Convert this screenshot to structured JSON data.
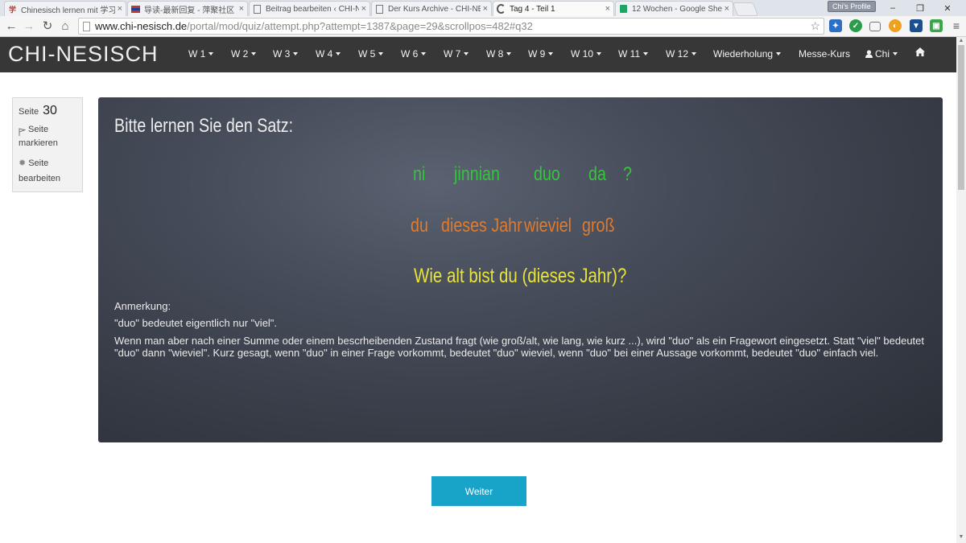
{
  "browser": {
    "tabs": [
      {
        "label": "Chinesisch lernen mit 学习",
        "icon": "chinese-char-favicon"
      },
      {
        "label": "导读-最新回复 - 萍聚社区",
        "icon": "flag-favicon"
      },
      {
        "label": "Beitrag bearbeiten ‹ CHI-N",
        "icon": "page-favicon"
      },
      {
        "label": "Der Kurs Archive - CHI-NE",
        "icon": "page-favicon"
      },
      {
        "label": "Tag 4 - Teil 1",
        "icon": "loading-favicon"
      },
      {
        "label": "12 Wochen - Google Shee",
        "icon": "sheets-favicon"
      }
    ],
    "profile_label": "Chi's Profile",
    "url_host": "www.chi-nesisch.de",
    "url_path": "/portal/mod/quiz/attempt.php?attempt=1387&page=29&scrollpos=482#q32",
    "colors": {
      "tabstrip": "#dfe3ea",
      "sheets_green": "#1fa463"
    }
  },
  "site": {
    "logo": "CHI-NESISCH",
    "menu": [
      {
        "label": "W 1",
        "dropdown": true
      },
      {
        "label": "W 2",
        "dropdown": true
      },
      {
        "label": "W 3",
        "dropdown": true
      },
      {
        "label": "W 4",
        "dropdown": true
      },
      {
        "label": "W 5",
        "dropdown": true
      },
      {
        "label": "W 6",
        "dropdown": true
      },
      {
        "label": "W 7",
        "dropdown": true
      },
      {
        "label": "W 8",
        "dropdown": true
      },
      {
        "label": "W 9",
        "dropdown": true
      },
      {
        "label": "W 10",
        "dropdown": true
      },
      {
        "label": "W 11",
        "dropdown": true
      },
      {
        "label": "W 12",
        "dropdown": true
      },
      {
        "label": "Wiederholung",
        "dropdown": true
      },
      {
        "label": "Messe-Kurs",
        "dropdown": false
      },
      {
        "label": "Chi",
        "dropdown": true,
        "icon": "user-icon"
      }
    ],
    "home_icon": "home-icon",
    "colors": {
      "navbar": "#373737",
      "button": "#18a3c8"
    }
  },
  "sidebar": {
    "page_label": "Seite",
    "page_number": "30",
    "flag_text_1": "Seite",
    "flag_text_2": "markieren",
    "edit_text_1": "Seite",
    "edit_text_2": "bearbeiten"
  },
  "question": {
    "heading": "Bitte lernen Sie den Satz:",
    "pinyin": [
      "ni",
      "jinnian",
      "duo",
      "da",
      "?"
    ],
    "german_words": [
      "du",
      "dieses Jahr",
      "wieviel",
      "groß"
    ],
    "translation": "Wie alt bist du (dieses Jahr)?",
    "note_label": "Anmerkung:",
    "note_line1": "\"duo\" bedeutet eigentlich nur \"viel\".",
    "note_line2": "Wenn man aber nach einer Summe oder einem bescrheibenden Zustand fragt (wie groß/alt, wie lang, wie kurz ...), wird \"duo\" als ein Fragewort eingesetzt. Statt \"viel\" bedeutet \"duo\" dann \"wieviel\". Kurz gesagt, wenn \"duo\" in einer Frage vorkommt, bedeutet \"duo\" wieviel, wenn \"duo\" bei einer Aussage vorkommt, bedeutet \"duo\" einfach viel.",
    "colors": {
      "pinyin": "#35c53c",
      "german": "#e07a2c",
      "translation": "#e7e33c"
    }
  },
  "next_button": "Weiter"
}
